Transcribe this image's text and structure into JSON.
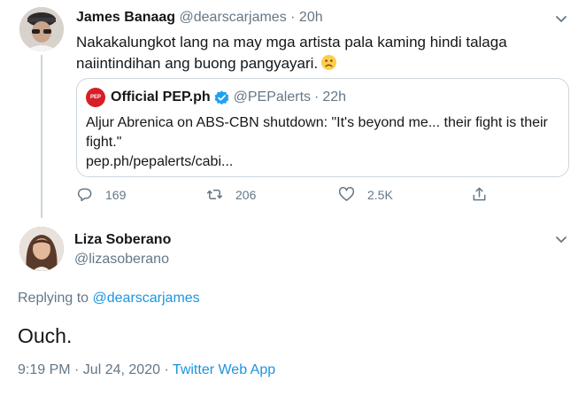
{
  "parent_tweet": {
    "author_name": "James Banaag",
    "author_handle": "@dearscarjames",
    "separator": "·",
    "time": "20h",
    "text": "Nakakalungkot lang na may mga artista pala kaming hindi talaga naiintindihan ang buong pangyayari.",
    "emoji": "sad-face-icon",
    "quote": {
      "logo_text": "PEP",
      "author_name": "Official PEP.ph",
      "author_handle": "@PEPalerts",
      "separator": "·",
      "time": "22h",
      "text": "Aljur Abrenica on ABS-CBN shutdown: \"It's beyond me... their fight is their fight.\"",
      "link": "pep.ph/pepalerts/cabi..."
    },
    "actions": {
      "replies": "169",
      "retweets": "206",
      "likes": "2.5K"
    }
  },
  "main_tweet": {
    "author_name": "Liza Soberano",
    "author_handle": "@lizasoberano",
    "replying_prefix": "Replying to",
    "replying_to": "@dearscarjames",
    "text": "Ouch.",
    "timestamp": "9:19 PM · Jul 24, 2020",
    "meta_separator": "·",
    "source": "Twitter Web App"
  },
  "colors": {
    "link_blue": "#1b95e0",
    "muted_gray": "#657786",
    "border": "#ccd6dd"
  }
}
